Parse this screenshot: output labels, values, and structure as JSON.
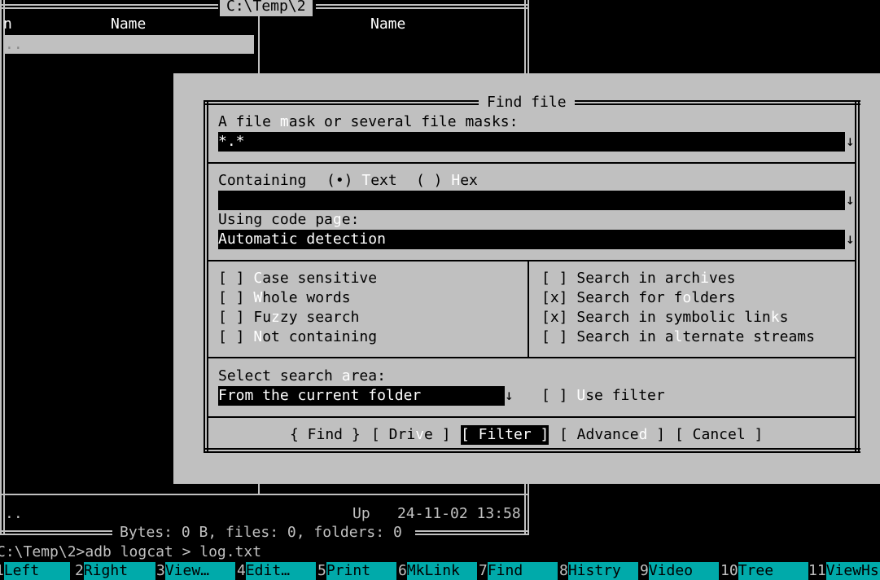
{
  "panel": {
    "path_title": "C:\\Temp\\2",
    "left_col_n": "n",
    "left_col_name": "Name",
    "right_col_name": "Name",
    "updir": "..",
    "status_left": "..",
    "status_up": "Up",
    "status_date": "24-11-02 13:58",
    "totals": "Bytes: 0 B, files: 0, folders: 0"
  },
  "command_line": "C:\\Temp\\2>adb logcat > log.txt",
  "dialog": {
    "title": "Find file",
    "mask": {
      "label_a": "A file ",
      "label_hot": "m",
      "label_b": "ask or several file masks:",
      "value": "*.*",
      "arrow": "↓"
    },
    "containing": {
      "label": "Containing",
      "text_radio": "(•) ",
      "text_hot": "T",
      "text_rest": "ext",
      "hex_radio": "( ) ",
      "hex_hot": "H",
      "hex_rest": "ex",
      "value": "",
      "arrow": "↓"
    },
    "codepage": {
      "label_a": "Using code pa",
      "label_hot": "g",
      "label_b": "e:",
      "value": "Automatic detection",
      "arrow": "↓"
    },
    "options_left": [
      {
        "box": "[ ] ",
        "a": "",
        "hot": "C",
        "b": "ase sensitive"
      },
      {
        "box": "[ ] ",
        "a": "",
        "hot": "W",
        "b": "hole words"
      },
      {
        "box": "[ ] ",
        "a": "Fu",
        "hot": "z",
        "b": "zy search"
      },
      {
        "box": "[ ] ",
        "a": "",
        "hot": "N",
        "b": "ot containing"
      }
    ],
    "options_right": [
      {
        "box": "[ ] ",
        "a": "Search in arch",
        "hot": "i",
        "b": "ves"
      },
      {
        "box": "[x] ",
        "a": "Search for f",
        "hot": "o",
        "b": "lders"
      },
      {
        "box": "[x] ",
        "a": "Search in symbolic lin",
        "hot": "k",
        "b": "s"
      },
      {
        "box": "[ ] ",
        "a": "Search in a",
        "hot": "l",
        "b": "ternate streams"
      }
    ],
    "area": {
      "label_a": "Select search ",
      "label_hot": "a",
      "label_b": "rea:",
      "value": "From the current folder",
      "arrow": "↓"
    },
    "use_filter": {
      "box": "[ ] ",
      "hot": "U",
      "b": "se filter"
    },
    "buttons": {
      "find": "{ Find }",
      "drive_a": "[ Dri",
      "drive_hot": "v",
      "drive_b": "e ]",
      "filter": "[ Filter ]",
      "adv_a": "[ Advance",
      "adv_hot": "d",
      "adv_b": " ]",
      "cancel": "[ Cancel ]"
    }
  },
  "keybar": [
    {
      "num": "1",
      "label": "Left"
    },
    {
      "num": "2",
      "label": "Right"
    },
    {
      "num": "3",
      "label": "View…"
    },
    {
      "num": "4",
      "label": "Edit…"
    },
    {
      "num": "5",
      "label": "Print"
    },
    {
      "num": "6",
      "label": "MkLink"
    },
    {
      "num": "7",
      "label": "Find"
    },
    {
      "num": "8",
      "label": "Histry"
    },
    {
      "num": "9",
      "label": "Video"
    },
    {
      "num": "10",
      "label": "Tree"
    },
    {
      "num": "11",
      "label": "ViewHs"
    }
  ],
  "colors": {
    "dialog_bg": "#c0c0c0",
    "screen_bg": "#000000",
    "keybar_label_bg": "#00aaaa"
  }
}
